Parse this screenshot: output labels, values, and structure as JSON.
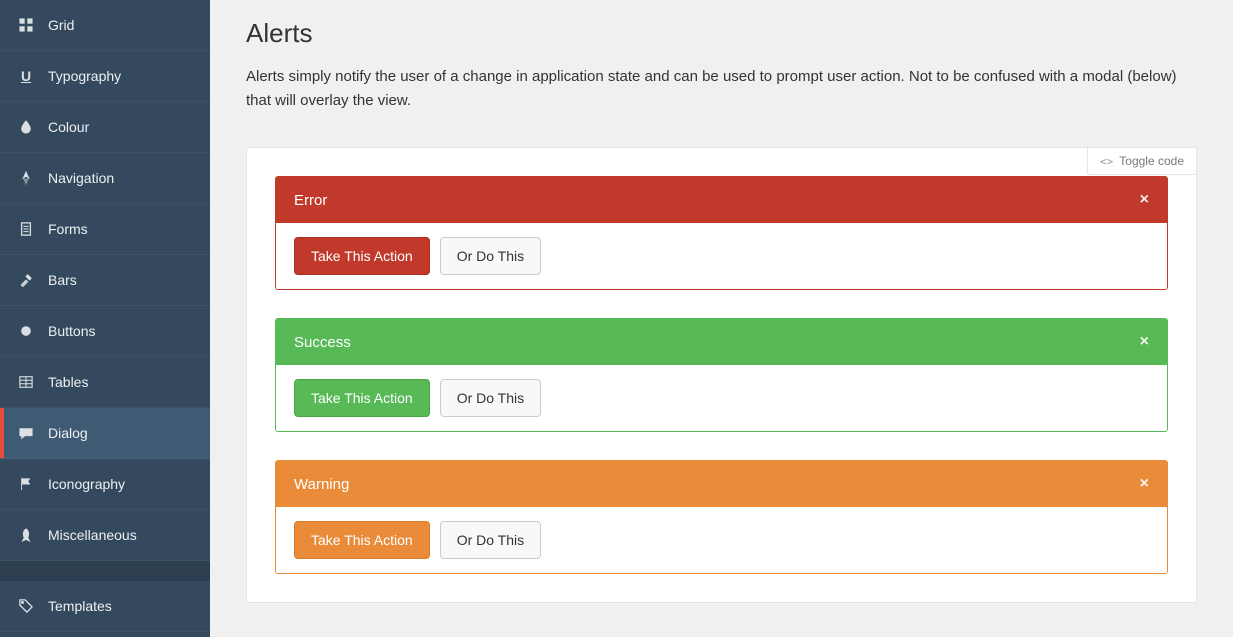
{
  "sidebar": {
    "items": [
      {
        "label": "Grid"
      },
      {
        "label": "Typography"
      },
      {
        "label": "Colour"
      },
      {
        "label": "Navigation"
      },
      {
        "label": "Forms"
      },
      {
        "label": "Bars"
      },
      {
        "label": "Buttons"
      },
      {
        "label": "Tables"
      },
      {
        "label": "Dialog"
      },
      {
        "label": "Iconography"
      },
      {
        "label": "Miscellaneous"
      }
    ],
    "footer": [
      {
        "label": "Templates"
      }
    ]
  },
  "page": {
    "title": "Alerts",
    "description": "Alerts simply notify the user of a change in application state and can be used to prompt user action. Not to be confused with a modal (below) that will overlay the view."
  },
  "toggle_code_label": "Toggle code",
  "alerts": [
    {
      "kind": "error",
      "title": "Error",
      "primary_label": "Take This Action",
      "secondary_label": "Or Do This",
      "close_glyph": "×"
    },
    {
      "kind": "success",
      "title": "Success",
      "primary_label": "Take This Action",
      "secondary_label": "Or Do This",
      "close_glyph": "×"
    },
    {
      "kind": "warning",
      "title": "Warning",
      "primary_label": "Take This Action",
      "secondary_label": "Or Do This",
      "close_glyph": "×"
    }
  ]
}
